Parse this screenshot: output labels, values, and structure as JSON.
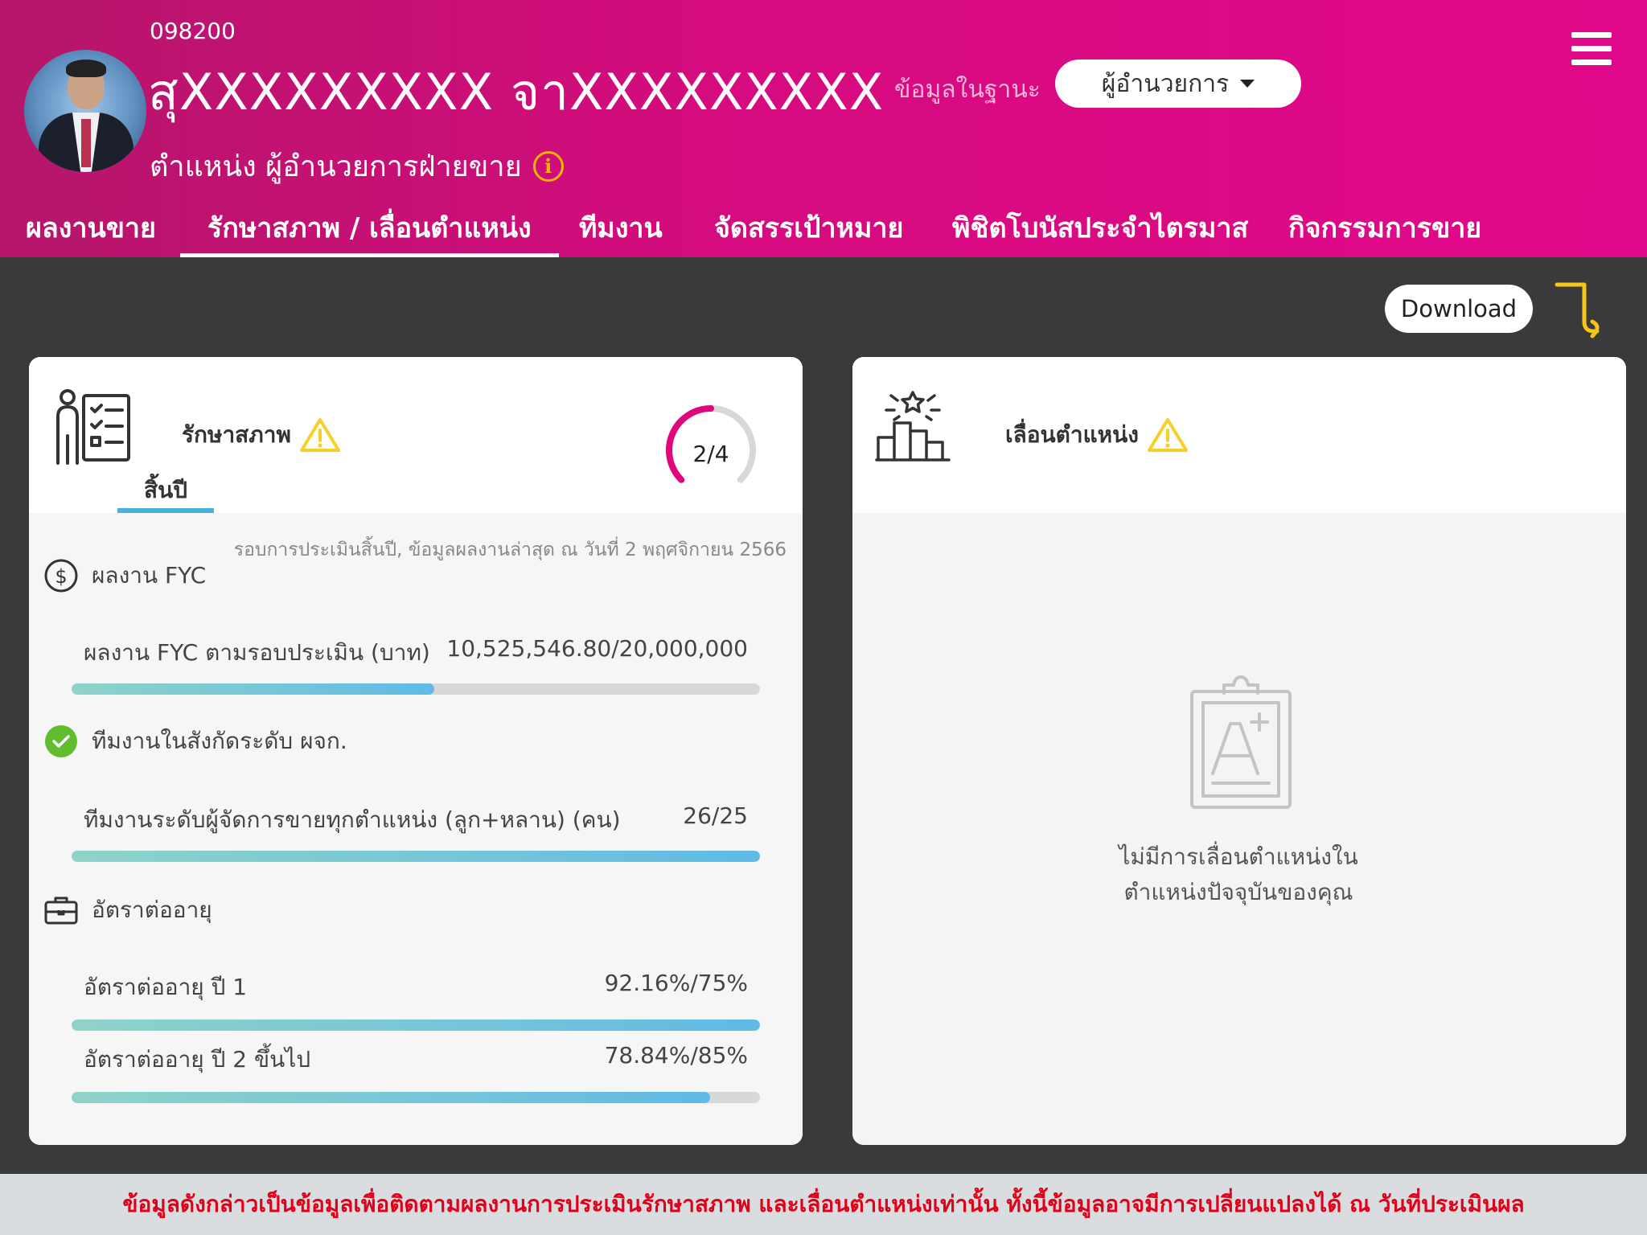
{
  "header": {
    "agent_code": "098200",
    "agent_name": "สุXXXXXXXXX จาXXXXXXXXX",
    "role_label": "ข้อมูลในฐานะ",
    "role_selected": "ผู้อำนวยการ",
    "position_text": "ตำแหน่ง ผู้อำนวยการฝ่ายขาย",
    "info_icon": "i",
    "colors": {
      "header_start": "#b5166a",
      "header_end": "#e0088a",
      "accent_yellow": "#f5b400"
    }
  },
  "tabs": [
    {
      "label": "ผลงานขาย",
      "active": false
    },
    {
      "label": "รักษาสภาพ / เลื่อนตำแหน่ง",
      "active": true
    },
    {
      "label": "ทีมงาน",
      "active": false
    },
    {
      "label": "จัดสรรเป้าหมาย",
      "active": false
    },
    {
      "label": "พิชิตโบนัสประจำไตรมาส",
      "active": false
    },
    {
      "label": "กิจกรรมการขาย",
      "active": false
    }
  ],
  "download": {
    "label": "Download"
  },
  "retention": {
    "title": "รักษาสภาพ",
    "gauge": {
      "text": "2/4",
      "achieved": 2,
      "total": 4
    },
    "subtab": "สิ้นปี",
    "round_note": "รอบการประเมินสิ้นปี, ข้อมูลผลงานล่าสุด ณ วันที่ 2 พฤศจิกายน 2566",
    "sections": [
      {
        "title": "ผลงาน FYC",
        "icon": "dollar-icon",
        "metrics": [
          {
            "label": "ผลงาน FYC ตามรอบประเมิน (บาท)",
            "value": "10,525,546.80/20,000,000",
            "progress": 0.5263
          }
        ]
      },
      {
        "title": "ทีมงานในสังกัดระดับ ผจก.",
        "icon": "check-circle-icon",
        "metrics": [
          {
            "label": "ทีมงานระดับผู้จัดการขายทุกตำแหน่ง (ลูก+หลาน) (คน)",
            "value": "26/25",
            "progress": 1.0
          }
        ]
      },
      {
        "title": "อัตราต่ออายุ",
        "icon": "briefcase-icon",
        "metrics": [
          {
            "label": "อัตราต่ออายุ ปี 1",
            "value": "92.16%/75%",
            "progress": 1.0
          },
          {
            "label": "อัตราต่ออายุ ปี 2 ขึ้นไป",
            "value": "78.84%/85%",
            "progress": 0.9275
          }
        ]
      }
    ]
  },
  "promotion": {
    "title": "เลื่อนตำแหน่ง",
    "empty_line1": "ไม่มีการเลื่อนตำแหน่งใน",
    "empty_line2": "ตำแหน่งปัจจุบันของคุณ"
  },
  "footer": {
    "disclaimer": "ข้อมูลดังกล่าวเป็นข้อมูลเพื่อติดตามผลงานการประเมินรักษาสภาพ และเลื่อนตำแหน่งเท่านั้น ทั้งนี้ข้อมูลอาจมีการเปลี่ยนแปลงได้ ณ วันที่ประเมินผล"
  }
}
